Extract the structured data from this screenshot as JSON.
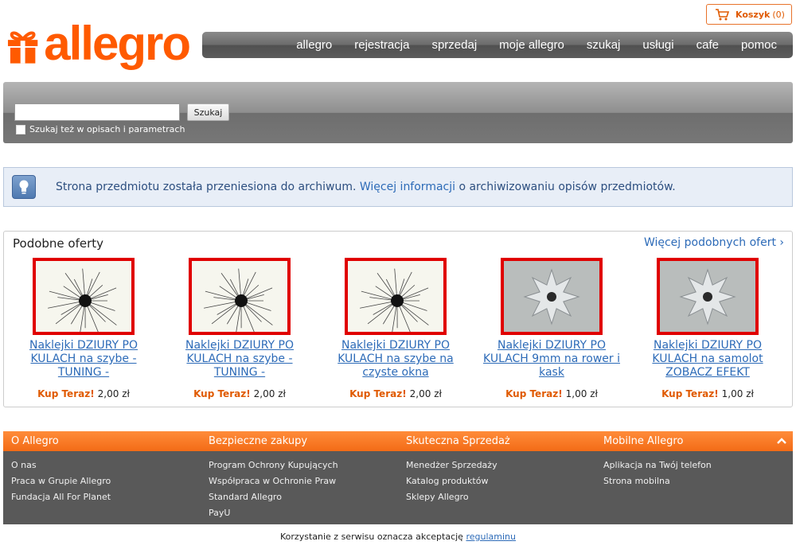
{
  "header": {
    "logo_text": "allegro",
    "brand_color": "#ff5a00",
    "cart": {
      "label": "Koszyk",
      "count": "(0)"
    },
    "nav": [
      "allegro",
      "rejestracja",
      "sprzedaj",
      "moje allegro",
      "szukaj",
      "usługi",
      "cafe",
      "pomoc"
    ]
  },
  "search": {
    "button_label": "Szukaj",
    "input_value": "",
    "checkbox_label": "Szukaj też w opisach i parametrach"
  },
  "info": {
    "text_before": "Strona przedmiotu została przeniesiona do archiwum. ",
    "link": "Więcej informacji",
    "text_after": " o archiwizowaniu opisów przedmiotów."
  },
  "similar": {
    "title": "Podobne oferty",
    "more_link": "Więcej podobnych ofert ›",
    "offers": [
      {
        "title": "Naklejki DZIURY PO KULACH na szybe - TUNING -",
        "kup_label": "Kup Teraz!",
        "price": "2,00 zł",
        "image": "cracked-glass"
      },
      {
        "title": "Naklejki DZIURY PO KULACH na szybe - TUNING -",
        "kup_label": "Kup Teraz!",
        "price": "2,00 zł",
        "image": "cracked-glass"
      },
      {
        "title": "Naklejki DZIURY PO KULACH na szybe na czyste okna",
        "kup_label": "Kup Teraz!",
        "price": "2,00 zł",
        "image": "cracked-glass"
      },
      {
        "title": "Naklejki DZIURY PO KULACH 9mm na rower i kask",
        "kup_label": "Kup Teraz!",
        "price": "1,00 zł",
        "image": "metal-hole"
      },
      {
        "title": "Naklejki DZIURY PO KULACH na samolot ZOBACZ EFEKT",
        "kup_label": "Kup Teraz!",
        "price": "1,00 zł",
        "image": "metal-hole"
      }
    ]
  },
  "footer": {
    "columns": [
      {
        "heading": "O Allegro",
        "links": [
          "O nas",
          "Praca w Grupie Allegro",
          "Fundacja All For Planet"
        ]
      },
      {
        "heading": "Bezpieczne zakupy",
        "links": [
          "Program Ochrony Kupujących",
          "Współpraca w Ochronie Praw",
          "Standard Allegro",
          "PayU"
        ]
      },
      {
        "heading": "Skuteczna Sprzedaż",
        "links": [
          "Menedżer Sprzedaży",
          "Katalog produktów",
          "Sklepy Allegro"
        ]
      },
      {
        "heading": "Mobilne Allegro",
        "links": [
          "Aplikacja na Twój telefon",
          "Strona mobilna"
        ]
      }
    ],
    "terms_text": "Korzystanie z serwisu oznacza akceptację ",
    "terms_link": "regulaminu"
  }
}
